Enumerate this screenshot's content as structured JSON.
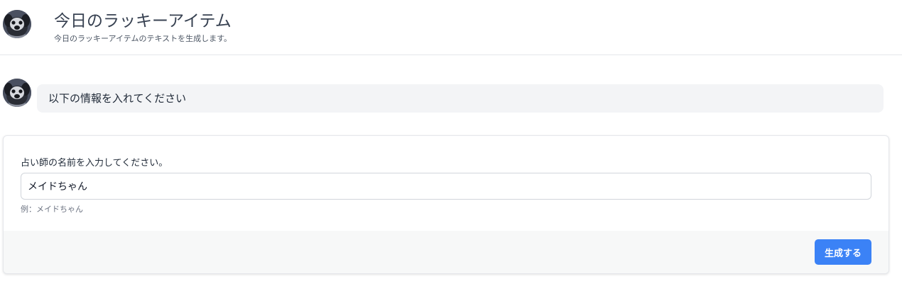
{
  "header": {
    "title": "今日のラッキーアイテム",
    "subtitle": "今日のラッキーアイテムのテキストを生成します。"
  },
  "chat": {
    "message": "以下の情報を入れてください"
  },
  "form": {
    "label": "占い師の名前を入力してください。",
    "input_value": "メイドちゃん",
    "hint": "例：メイドちゃん",
    "submit_label": "生成する"
  },
  "colors": {
    "accent": "#3b82f6",
    "bubble_bg": "#f3f4f6",
    "footer_bg": "#f7f8f8"
  },
  "icons": {
    "avatar": "dog-avatar-icon"
  }
}
